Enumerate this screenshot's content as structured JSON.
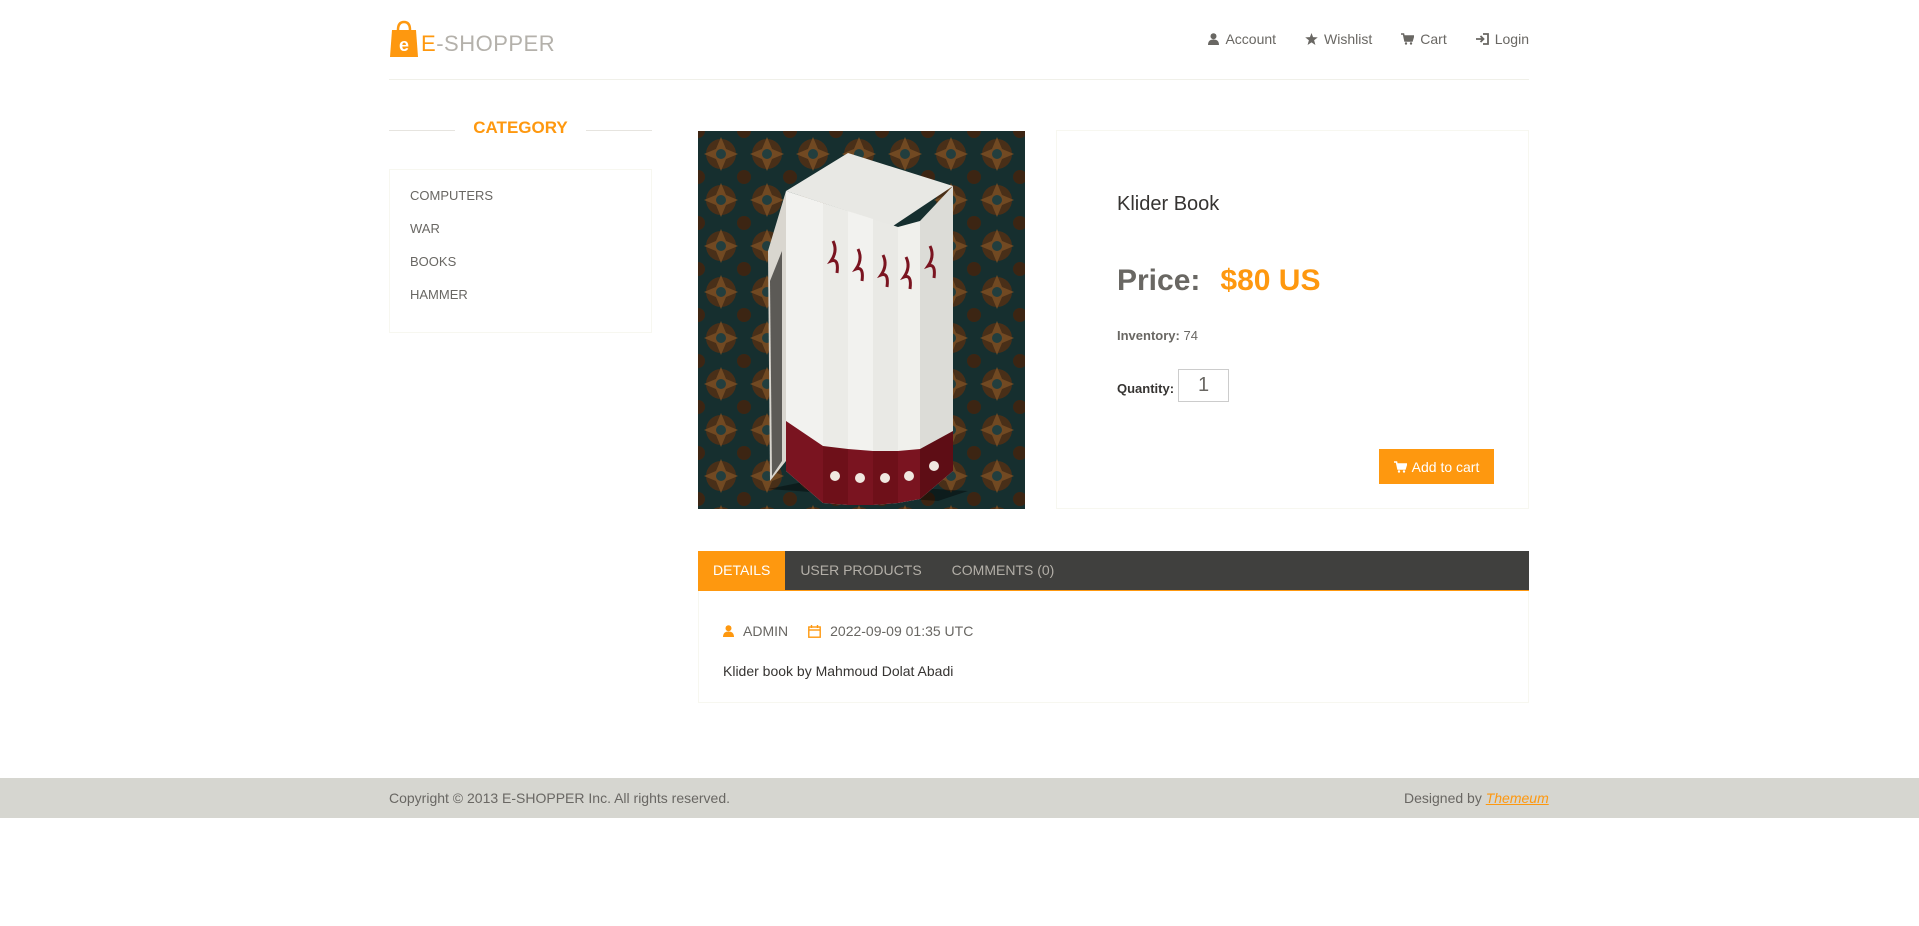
{
  "brand": {
    "prefix": "E",
    "name": "-SHOPPER",
    "accent": "#fe980f",
    "icon": "shopping-bag-icon"
  },
  "nav": [
    {
      "label": "Account",
      "icon": "user-icon"
    },
    {
      "label": "Wishlist",
      "icon": "star-icon"
    },
    {
      "label": "Cart",
      "icon": "shopping-cart-icon"
    },
    {
      "label": "Login",
      "icon": "sign-in-icon"
    }
  ],
  "sidebar": {
    "title": "CATEGORY",
    "items": [
      {
        "label": "COMPUTERS"
      },
      {
        "label": "WAR"
      },
      {
        "label": "BOOKS"
      },
      {
        "label": "HAMMER"
      }
    ]
  },
  "product": {
    "name": "Klider Book",
    "price_label": "Price:",
    "price_value": "$80 US",
    "inventory_label": "Inventory:",
    "inventory_value": "74",
    "quantity_label": "Quantity:",
    "quantity_value": "1",
    "add_to_cart_label": "Add to cart"
  },
  "tabs": [
    {
      "label": "DETAILS",
      "active": true
    },
    {
      "label": "USER PRODUCTS",
      "active": false
    },
    {
      "label": "COMMENTS (0)",
      "active": false
    }
  ],
  "details": {
    "author": "ADMIN",
    "date": "2022-09-09 01:35 UTC",
    "description": "Klider book by Mahmoud Dolat Abadi"
  },
  "footer": {
    "copyright": "Copyright © 2013 E-SHOPPER Inc. All rights reserved.",
    "designed_prefix": "Designed by ",
    "designed_link": "Themeum"
  }
}
